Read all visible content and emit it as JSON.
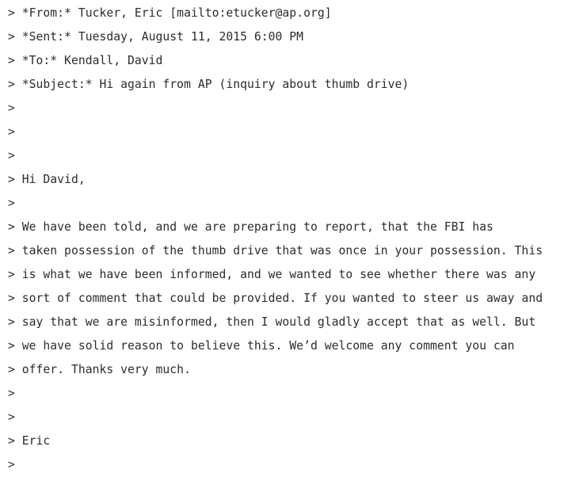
{
  "document": {
    "kind": "quoted-email-plaintext",
    "colors": {
      "background": "#ffffff",
      "text": "#2b2b33"
    },
    "headers": {
      "from_line": "> *From:* Tucker, Eric [mailto:etucker@ap.org]",
      "sent_line": "> *Sent:* Tuesday, August 11, 2015 6:00 PM",
      "to_line": "> *To:* Kendall, David",
      "subject_line": "> *Subject:* Hi again from AP (inquiry about thumb drive)",
      "from_name": "Tucker, Eric",
      "from_email": "etucker@ap.org",
      "sent_date": "Tuesday, August 11, 2015 6:00 PM",
      "to_name": "Kendall, David",
      "subject": "Hi again from AP (inquiry about thumb drive)"
    },
    "quote_marker": ">",
    "lines": [
      "> *From:* Tucker, Eric [mailto:etucker@ap.org]",
      "> *Sent:* Tuesday, August 11, 2015 6:00 PM",
      "> *To:* Kendall, David",
      "> *Subject:* Hi again from AP (inquiry about thumb drive)",
      ">",
      ">",
      ">",
      "> Hi David,",
      ">",
      "> We have been told, and we are preparing to report, that the FBI has",
      "> taken possession of the thumb drive that was once in your possession. This",
      "> is what we have been informed, and we wanted to see whether there was any",
      "> sort of comment that could be provided. If you wanted to steer us away and",
      "> say that we are misinformed, then I would gladly accept that as well. But",
      "> we have solid reason to believe this. We’d welcome any comment you can",
      "> offer. Thanks very much.",
      ">",
      ">",
      "> Eric",
      ">"
    ],
    "body": {
      "salutation": "Hi David,",
      "paragraph": "We have been told, and we are preparing to report, that the FBI has taken possession of the thumb drive that was once in your possession. This is what we have been informed, and we wanted to see whether there was any sort of comment that could be provided. If you wanted to steer us away and say that we are misinformed, then I would gladly accept that as well. But we have solid reason to believe this. We’d welcome any comment you can offer. Thanks very much.",
      "signature": "Eric"
    }
  }
}
